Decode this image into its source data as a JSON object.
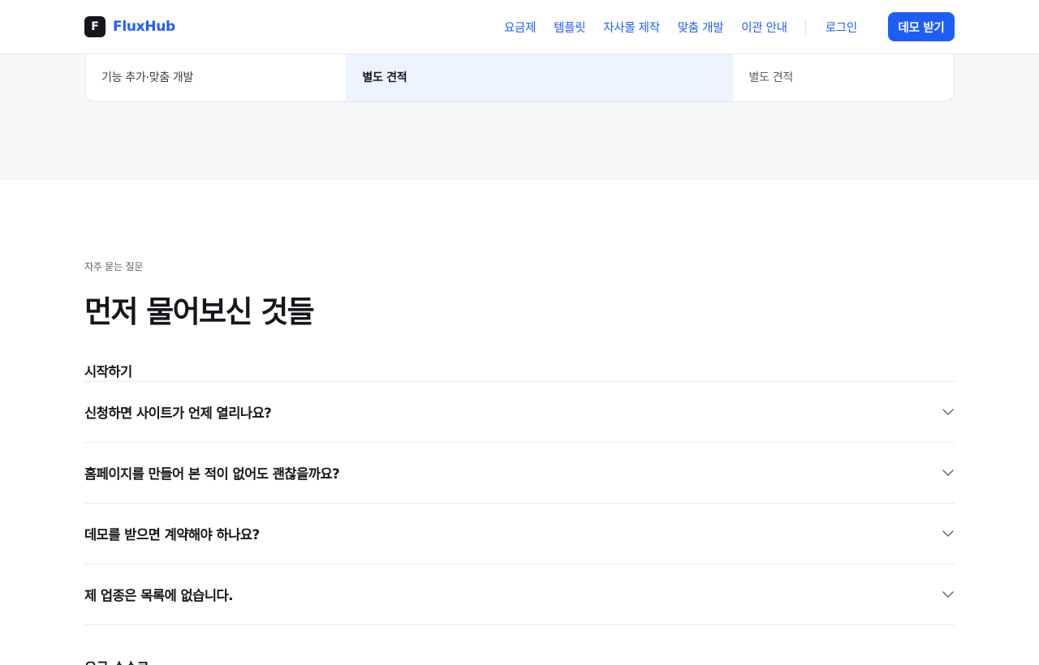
{
  "nav": {
    "brand_mark": "F",
    "brand_name": "FluxHub",
    "links": [
      {
        "label": "요금제"
      },
      {
        "label": "템플릿"
      },
      {
        "label": "자사몰 제작"
      },
      {
        "label": "맞춤 개발"
      },
      {
        "label": "이관 안내"
      }
    ],
    "login_label": "로그인",
    "demo_label": "데모 받기"
  },
  "pricing": {
    "row": {
      "feature": "기능 추가·맞춤 개발",
      "plan_mid": "별도 견적",
      "plan_right": "별도 견적"
    }
  },
  "faq": {
    "eyebrow": "자주 묻는 질문",
    "title": "먼저 물어보신 것들",
    "groups": [
      {
        "title": "시작하기",
        "items": [
          {
            "question": "신청하면 사이트가 언제 열리나요?"
          },
          {
            "question": "홈페이지를 만들어 본 적이 없어도 괜찮을까요?"
          },
          {
            "question": "데모를 받으면 계약해야 하나요?"
          },
          {
            "question": "제 업종은 목록에 없습니다."
          }
        ]
      }
    ],
    "next_group_title": "요금·수수료"
  },
  "colors": {
    "accent": "#1f5ef5",
    "text": "#15171c",
    "section_bg": "#f6f7f9",
    "highlight_bg": "#edf3ff"
  },
  "icons": {
    "faq_toggle": "chevron-down-icon"
  }
}
